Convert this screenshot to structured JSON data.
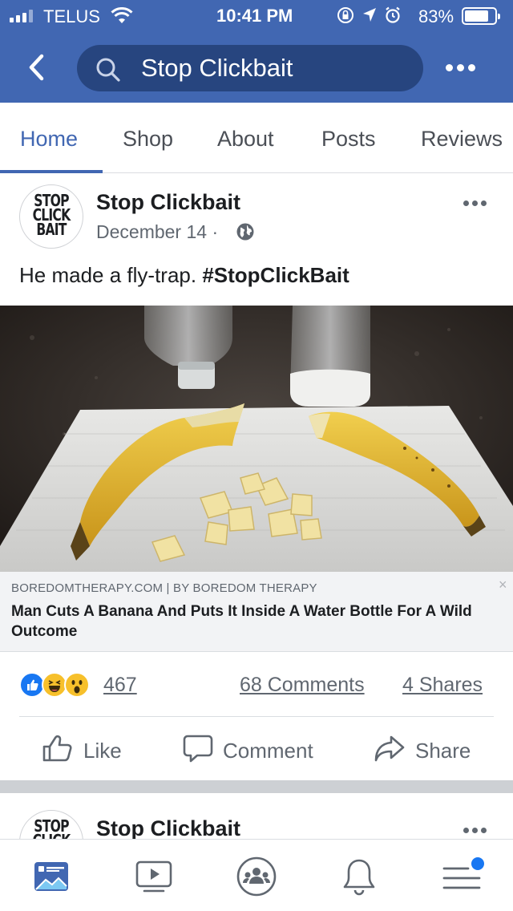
{
  "status_bar": {
    "carrier": "TELUS",
    "time": "10:41 PM",
    "battery": "83%",
    "battery_level": 0.83,
    "icons": [
      "signal-icon",
      "wifi-icon",
      "orientation-lock-icon",
      "location-icon",
      "alarm-icon",
      "battery-icon"
    ]
  },
  "header": {
    "search_text": "Stop Clickbait",
    "icons": [
      "back-arrow-icon",
      "search-icon",
      "more-icon"
    ],
    "background": "#4167b2"
  },
  "tabs": [
    {
      "label": "Home",
      "active": true
    },
    {
      "label": "Shop",
      "active": false
    },
    {
      "label": "About",
      "active": false
    },
    {
      "label": "Posts",
      "active": false
    },
    {
      "label": "Reviews",
      "active": false
    }
  ],
  "post": {
    "avatar_text": [
      "STOP",
      "CLICK",
      "BAIT"
    ],
    "page_name": "Stop Clickbait",
    "date": "December 14 ·",
    "text": "He made a fly-trap. ",
    "hashtag": "#StopClickBait",
    "link": {
      "source": "BOREDOMTHERAPY.COM | BY BOREDOM THERAPY",
      "title": "Man Cuts A Banana And Puts It Inside A Water Bottle For A Wild Outcome",
      "close": "×"
    },
    "reactions": [
      "like-reaction-icon",
      "haha-reaction-icon",
      "wow-reaction-icon"
    ],
    "reaction_count": "467",
    "comments": "68 Comments",
    "shares": "4 Shares",
    "actions": {
      "like": "Like",
      "comment": "Comment",
      "share": "Share"
    }
  },
  "next_post": {
    "avatar_text": [
      "STOP",
      "CLICK"
    ],
    "page_name": "Stop Clickbait"
  },
  "bottom_nav": [
    "news-feed-icon",
    "watch-icon",
    "groups-icon",
    "notifications-icon",
    "menu-icon"
  ],
  "colors": {
    "facebook_blue": "#4167b2",
    "search_bg": "#27457f",
    "secondary_text": "#606770",
    "notification_dot": "#1877f2"
  }
}
